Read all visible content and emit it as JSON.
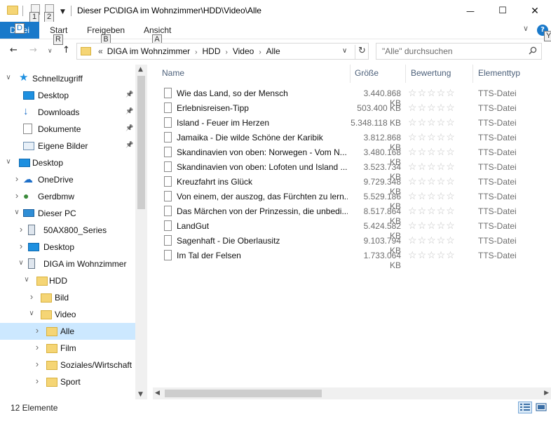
{
  "window": {
    "title": "Dieser PC\\DIGA im Wohnzimmer\\HDD\\Video\\Alle",
    "minimize_glyph": "—",
    "maximize_glyph": "☐",
    "close_glyph": "✕"
  },
  "quick_access_keytips": [
    "1",
    "2"
  ],
  "ribbon": {
    "file_label": "Datei",
    "file_keytip": "D",
    "tabs": [
      {
        "label": "Start",
        "keytip": "R"
      },
      {
        "label": "Freigeben",
        "keytip": "B"
      },
      {
        "label": "Ansicht",
        "keytip": "A"
      }
    ],
    "help_keytip": "Y"
  },
  "address": {
    "overflow": "«",
    "crumbs": [
      "DIGA im Wohnzimmer",
      "HDD",
      "Video",
      "Alle"
    ]
  },
  "search": {
    "placeholder": "\"Alle\" durchsuchen"
  },
  "nav": {
    "items": [
      {
        "label": "Schnellzugriff",
        "icon": "star-icon",
        "level": 0,
        "expanded": true,
        "pinned": false
      },
      {
        "label": "Desktop",
        "icon": "desktop-icon",
        "level": 1,
        "pinned": true
      },
      {
        "label": "Downloads",
        "icon": "download-icon",
        "level": 1,
        "pinned": true
      },
      {
        "label": "Dokumente",
        "icon": "document-icon",
        "level": 1,
        "pinned": true
      },
      {
        "label": "Eigene Bilder",
        "icon": "pictures-icon",
        "level": 1,
        "pinned": true
      },
      {
        "label": "Desktop",
        "icon": "desktop-icon",
        "level": 0,
        "expanded": true
      },
      {
        "label": "OneDrive",
        "icon": "cloud-icon",
        "level": 1,
        "expanded": false
      },
      {
        "label": "Gerdbmw",
        "icon": "user-icon",
        "level": 1,
        "expanded": false
      },
      {
        "label": "Dieser PC",
        "icon": "computer-icon",
        "level": 1,
        "expanded": true
      },
      {
        "label": "50AX800_Series",
        "icon": "media-device-icon",
        "level": 2,
        "expanded": false
      },
      {
        "label": "Desktop",
        "icon": "desktop-icon",
        "level": 2,
        "expanded": false
      },
      {
        "label": "DIGA im Wohnzimmer",
        "icon": "media-device-icon",
        "level": 2,
        "expanded": true
      },
      {
        "label": "HDD",
        "icon": "folder-icon",
        "level": 3,
        "expanded": true
      },
      {
        "label": "Bild",
        "icon": "folder-icon",
        "level": 4,
        "expanded": false
      },
      {
        "label": "Video",
        "icon": "folder-icon",
        "level": 4,
        "expanded": true
      },
      {
        "label": "Alle",
        "icon": "folder-icon",
        "level": 5,
        "expanded": false,
        "selected": true
      },
      {
        "label": "Film",
        "icon": "folder-icon",
        "level": 5,
        "expanded": false
      },
      {
        "label": "Soziales/Wirtschaft",
        "icon": "folder-icon",
        "level": 5,
        "expanded": false
      },
      {
        "label": "Sport",
        "icon": "folder-icon",
        "level": 5,
        "expanded": false
      }
    ]
  },
  "columns": {
    "name": "Name",
    "size": "Größe",
    "rating": "Bewertung",
    "type": "Elementtyp"
  },
  "files": [
    {
      "name": "Wie das Land, so der Mensch",
      "size": "3.440.868 KB",
      "type": "TTS-Datei",
      "rating": 0
    },
    {
      "name": "Erlebnisreisen-Tipp",
      "size": "503.400 KB",
      "type": "TTS-Datei",
      "rating": 0
    },
    {
      "name": "Island - Feuer im Herzen",
      "size": "5.348.118 KB",
      "type": "TTS-Datei",
      "rating": 0
    },
    {
      "name": "Jamaika - Die wilde Schöne der Karibik",
      "size": "3.812.868 KB",
      "type": "TTS-Datei",
      "rating": 0
    },
    {
      "name": "Skandinavien von oben: Norwegen - Vom N...",
      "size": "3.480.168 KB",
      "type": "TTS-Datei",
      "rating": 0
    },
    {
      "name": "Skandinavien von oben: Lofoten und Island ...",
      "size": "3.523.734 KB",
      "type": "TTS-Datei",
      "rating": 0
    },
    {
      "name": "Kreuzfahrt ins Glück",
      "size": "9.729.348 KB",
      "type": "TTS-Datei",
      "rating": 0
    },
    {
      "name": "Von einem, der auszog, das Fürchten zu lern...",
      "size": "5.529.186 KB",
      "type": "TTS-Datei",
      "rating": 0
    },
    {
      "name": "Das Märchen von der Prinzessin, die unbedi...",
      "size": "8.517.864 KB",
      "type": "TTS-Datei",
      "rating": 0
    },
    {
      "name": "LandGut",
      "size": "5.424.582 KB",
      "type": "TTS-Datei",
      "rating": 0
    },
    {
      "name": "Sagenhaft - Die Oberlausitz",
      "size": "9.103.794 KB",
      "type": "TTS-Datei",
      "rating": 0
    },
    {
      "name": "Im Tal der Felsen",
      "size": "1.733.064 KB",
      "type": "TTS-Datei",
      "rating": 0
    }
  ],
  "status": {
    "count_text": "12 Elemente"
  }
}
